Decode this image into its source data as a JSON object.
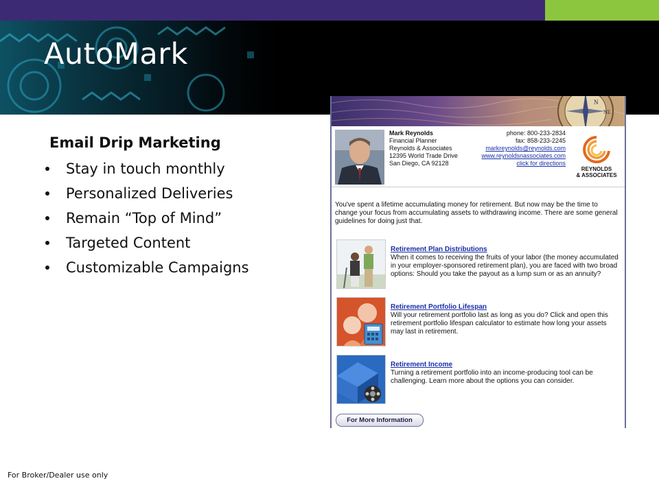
{
  "slide": {
    "title": "AutoMark",
    "subheading": "Email Drip Marketing",
    "bullets": [
      "Stay in touch monthly",
      "Personalized Deliveries",
      "Remain “Top of Mind”",
      "Targeted Content",
      "Customizable Campaigns"
    ],
    "footer": "For Broker/Dealer use only"
  },
  "email": {
    "advisor": {
      "name": "Mark Reynolds",
      "title": "Financial Planner",
      "firm": "Reynolds & Associates",
      "street": "12395 World Trade Drive",
      "city": "San Diego, CA 92128"
    },
    "contact": {
      "phone": "phone: 800-233-2834",
      "fax": "fax: 858-233-2245",
      "email": "markreynolds@reynolds.com",
      "website": "www.reynoldsnassociates.com",
      "directions": "click for directions"
    },
    "logo": {
      "line1": "REYNOLDS",
      "line2": "& ASSOCIATES"
    },
    "intro": "You've spent a lifetime accumulating money for retirement. But now may be the time to change your focus from accumulating assets to withdrawing income. There are some general guidelines for doing just that.",
    "articles": [
      {
        "title": "Retirement Plan Distributions",
        "body": "When it comes to receiving the fruits of your labor (the money accumulated in your employer-sponsored retirement plan), you are faced with two broad options: Should you take the payout as a lump sum or as an annuity?"
      },
      {
        "title": "Retirement Portfolio Lifespan",
        "body": "Will your retirement portfolio last as long as you do? Click and open this retirement portfolio lifespan calculator to estimate how long your assets may last in retirement."
      },
      {
        "title": "Retirement Income",
        "body": "Turning a retirement portfolio into an income-producing tool can be challenging. Learn more about the options you can consider."
      }
    ],
    "more_button": "For More Information"
  },
  "colors": {
    "top_bar": "#3d2a74",
    "accent_green": "#8cc63f",
    "header_bg": "#000000",
    "link_blue": "#1a2ea8"
  }
}
